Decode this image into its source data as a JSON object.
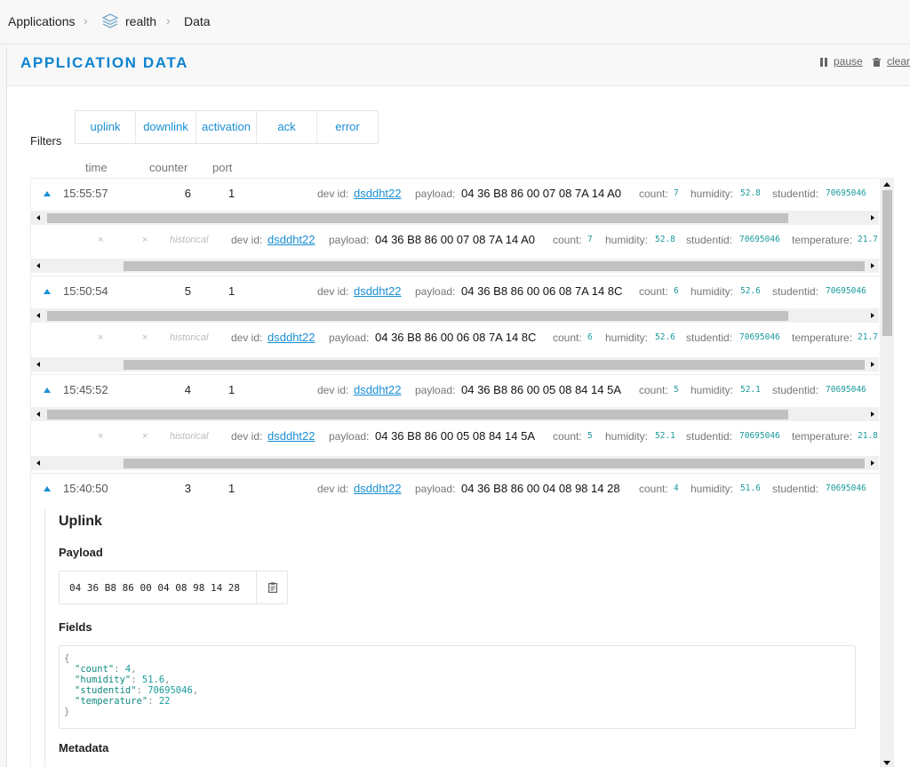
{
  "breadcrumb": {
    "root": "Applications",
    "app": "realth",
    "page": "Data"
  },
  "panel": {
    "title": "APPLICATION DATA",
    "pause": "pause",
    "clear": "clear"
  },
  "filters": {
    "label": "Filters",
    "buttons": [
      "uplink",
      "downlink",
      "activation",
      "ack",
      "error"
    ]
  },
  "columns": {
    "time": "time",
    "counter": "counter",
    "port": "port"
  },
  "labels": {
    "dev_id": "dev id:",
    "payload": "payload:",
    "count": "count:",
    "humidity": "humidity:",
    "studentid": "studentid:",
    "temperature": "temperature:",
    "historical": "historical",
    "x": "×"
  },
  "rows": [
    {
      "time": "15:55:57",
      "counter": "6",
      "port": "1",
      "dev_id": "dsddht22",
      "payload": "04 36 B8 86 00 07 08 7A 14 A0",
      "count": "7",
      "humidity": "52.8",
      "studentid": "70695046",
      "temperature": "21.7"
    },
    {
      "time": "15:50:54",
      "counter": "5",
      "port": "1",
      "dev_id": "dsddht22",
      "payload": "04 36 B8 86 00 06 08 7A 14 8C",
      "count": "6",
      "humidity": "52.6",
      "studentid": "70695046",
      "temperature": "21.7"
    },
    {
      "time": "15:45:52",
      "counter": "4",
      "port": "1",
      "dev_id": "dsddht22",
      "payload": "04 36 B8 86 00 05 08 84 14 5A",
      "count": "5",
      "humidity": "52.1",
      "studentid": "70695046",
      "temperature": "21.8"
    },
    {
      "time": "15:40:50",
      "counter": "3",
      "port": "1",
      "dev_id": "dsddht22",
      "payload": "04 36 B8 86 00 04 08 98 14 28",
      "count": "4",
      "humidity": "51.6",
      "studentid": "70695046"
    }
  ],
  "detail": {
    "title": "Uplink",
    "payload_label": "Payload",
    "payload_value": "04 36 B8 86 00 04 08 98 14 28",
    "fields_label": "Fields",
    "fields": {
      "open": "{",
      "close": "}",
      "count_key": "\"count\"",
      "count_val": "4",
      "humidity_key": "\"humidity\"",
      "humidity_val": "51.6",
      "studentid_key": "\"studentid\"",
      "studentid_val": "70695046",
      "temperature_key": "\"temperature\"",
      "temperature_val": "22"
    },
    "metadata_label": "Metadata"
  },
  "icons": {
    "stack": "layers-icon",
    "pause": "pause-icon",
    "clear": "trash-icon",
    "copy": "clipboard-icon"
  },
  "colors": {
    "accent": "#0d83d0",
    "link": "#1a8fd4",
    "mono_value": "#1a9a9a"
  }
}
